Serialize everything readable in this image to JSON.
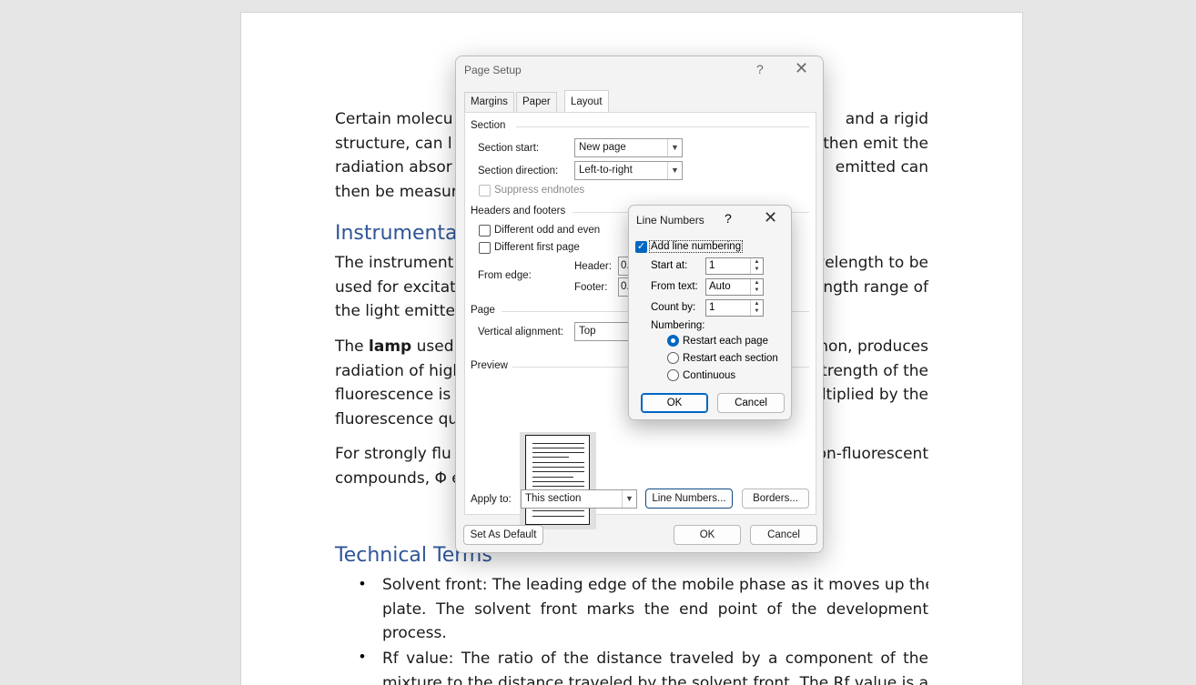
{
  "document": {
    "para1": [
      "Certain molecu",
      "and a rigid",
      "structure, can l",
      "then emit the",
      "radiation absor",
      "emitted can",
      "then be measure"
    ],
    "heading_instrumentation": "Instrumentat",
    "para2": [
      "The instrument",
      "velength to be",
      "used for excitat",
      "ngth range of",
      "the light emitted"
    ],
    "para3_lamp_prefix": "The ",
    "para3_lamp_bold": "lamp",
    "para3_lamp_suffix": " used,",
    "para3": [
      "non, produces",
      "radiation of high",
      "trength of the",
      "fluorescence is r",
      "ltiplied by the",
      "fluorescence qua"
    ],
    "para4": [
      "For strongly flu",
      "on-fluorescent",
      "compounds, Φ e"
    ],
    "heading_terms": "Technical Terms",
    "bullet1": [
      "Solvent front: The leading edge of the mobile phase as it moves up the",
      "plate. The solvent front marks the end point of the development",
      "process."
    ],
    "bullet2": [
      "Rf value: The ratio of the distance traveled by a component of the",
      "mixture to the distance traveled by the solvent front. The Rf value is a"
    ],
    "bullet_char": "•"
  },
  "page_setup": {
    "title": "Page Setup",
    "help": "?",
    "close": "✕",
    "tabs": [
      "Margins",
      "Paper",
      "Layout"
    ],
    "active_tab": "Layout",
    "section_group": "Section",
    "section_start_label": "Section start:",
    "section_start_value": "New page",
    "section_direction_label": "Section direction:",
    "section_direction_value": "Left-to-right",
    "suppress_endnotes": "Suppress endnotes",
    "headers_footers_group": "Headers and footers",
    "different_odd_even": "Different odd and even",
    "different_first_page": "Different first page",
    "from_edge_label": "From edge:",
    "header_label": "Header:",
    "header_value": "0.",
    "footer_label": "Footer:",
    "footer_value": "0.",
    "page_group": "Page",
    "vertical_alignment_label": "Vertical alignment:",
    "vertical_alignment_value": "Top",
    "preview_group": "Preview",
    "apply_to_label": "Apply to:",
    "apply_to_value": "This section",
    "line_numbers_button": "Line Numbers...",
    "borders_button": "Borders...",
    "set_as_default": "Set As Default",
    "ok": "OK",
    "cancel": "Cancel"
  },
  "line_numbers": {
    "title": "Line Numbers",
    "help": "?",
    "close": "✕",
    "add_line_numbering": "Add line numbering",
    "add_line_numbering_checked": true,
    "start_at_label": "Start at:",
    "start_at_value": "1",
    "from_text_label": "From text:",
    "from_text_value": "Auto",
    "count_by_label": "Count by:",
    "count_by_value": "1",
    "numbering_label": "Numbering:",
    "options": [
      "Restart each page",
      "Restart each section",
      "Continuous"
    ],
    "selected_option": "Restart each page",
    "ok": "OK",
    "cancel": "Cancel"
  },
  "colors": {
    "accent": "#0067c0",
    "heading": "#2f5597"
  }
}
